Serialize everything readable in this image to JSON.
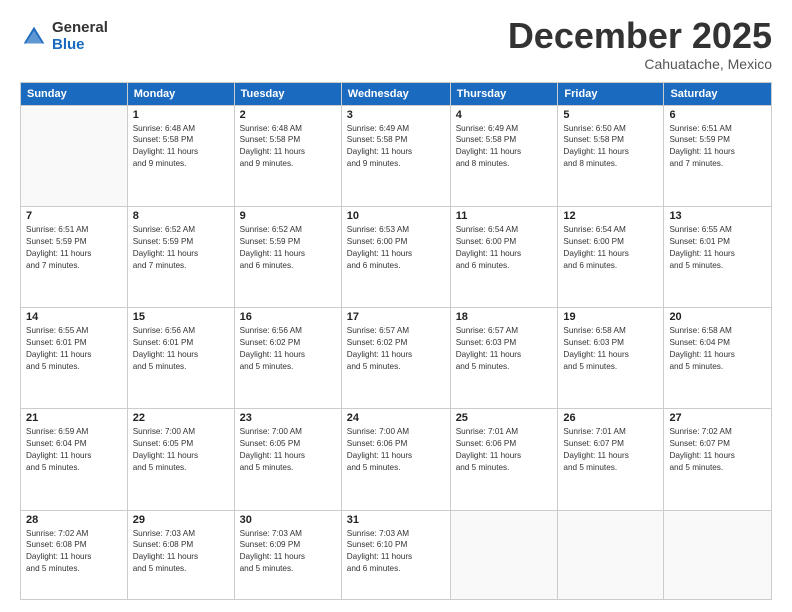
{
  "logo": {
    "general": "General",
    "blue": "Blue"
  },
  "header": {
    "month": "December 2025",
    "location": "Cahuatache, Mexico"
  },
  "weekdays": [
    "Sunday",
    "Monday",
    "Tuesday",
    "Wednesday",
    "Thursday",
    "Friday",
    "Saturday"
  ],
  "weeks": [
    [
      {
        "num": "",
        "info": ""
      },
      {
        "num": "1",
        "info": "Sunrise: 6:48 AM\nSunset: 5:58 PM\nDaylight: 11 hours\nand 9 minutes."
      },
      {
        "num": "2",
        "info": "Sunrise: 6:48 AM\nSunset: 5:58 PM\nDaylight: 11 hours\nand 9 minutes."
      },
      {
        "num": "3",
        "info": "Sunrise: 6:49 AM\nSunset: 5:58 PM\nDaylight: 11 hours\nand 9 minutes."
      },
      {
        "num": "4",
        "info": "Sunrise: 6:49 AM\nSunset: 5:58 PM\nDaylight: 11 hours\nand 8 minutes."
      },
      {
        "num": "5",
        "info": "Sunrise: 6:50 AM\nSunset: 5:58 PM\nDaylight: 11 hours\nand 8 minutes."
      },
      {
        "num": "6",
        "info": "Sunrise: 6:51 AM\nSunset: 5:59 PM\nDaylight: 11 hours\nand 7 minutes."
      }
    ],
    [
      {
        "num": "7",
        "info": "Sunrise: 6:51 AM\nSunset: 5:59 PM\nDaylight: 11 hours\nand 7 minutes."
      },
      {
        "num": "8",
        "info": "Sunrise: 6:52 AM\nSunset: 5:59 PM\nDaylight: 11 hours\nand 7 minutes."
      },
      {
        "num": "9",
        "info": "Sunrise: 6:52 AM\nSunset: 5:59 PM\nDaylight: 11 hours\nand 6 minutes."
      },
      {
        "num": "10",
        "info": "Sunrise: 6:53 AM\nSunset: 6:00 PM\nDaylight: 11 hours\nand 6 minutes."
      },
      {
        "num": "11",
        "info": "Sunrise: 6:54 AM\nSunset: 6:00 PM\nDaylight: 11 hours\nand 6 minutes."
      },
      {
        "num": "12",
        "info": "Sunrise: 6:54 AM\nSunset: 6:00 PM\nDaylight: 11 hours\nand 6 minutes."
      },
      {
        "num": "13",
        "info": "Sunrise: 6:55 AM\nSunset: 6:01 PM\nDaylight: 11 hours\nand 5 minutes."
      }
    ],
    [
      {
        "num": "14",
        "info": "Sunrise: 6:55 AM\nSunset: 6:01 PM\nDaylight: 11 hours\nand 5 minutes."
      },
      {
        "num": "15",
        "info": "Sunrise: 6:56 AM\nSunset: 6:01 PM\nDaylight: 11 hours\nand 5 minutes."
      },
      {
        "num": "16",
        "info": "Sunrise: 6:56 AM\nSunset: 6:02 PM\nDaylight: 11 hours\nand 5 minutes."
      },
      {
        "num": "17",
        "info": "Sunrise: 6:57 AM\nSunset: 6:02 PM\nDaylight: 11 hours\nand 5 minutes."
      },
      {
        "num": "18",
        "info": "Sunrise: 6:57 AM\nSunset: 6:03 PM\nDaylight: 11 hours\nand 5 minutes."
      },
      {
        "num": "19",
        "info": "Sunrise: 6:58 AM\nSunset: 6:03 PM\nDaylight: 11 hours\nand 5 minutes."
      },
      {
        "num": "20",
        "info": "Sunrise: 6:58 AM\nSunset: 6:04 PM\nDaylight: 11 hours\nand 5 minutes."
      }
    ],
    [
      {
        "num": "21",
        "info": "Sunrise: 6:59 AM\nSunset: 6:04 PM\nDaylight: 11 hours\nand 5 minutes."
      },
      {
        "num": "22",
        "info": "Sunrise: 7:00 AM\nSunset: 6:05 PM\nDaylight: 11 hours\nand 5 minutes."
      },
      {
        "num": "23",
        "info": "Sunrise: 7:00 AM\nSunset: 6:05 PM\nDaylight: 11 hours\nand 5 minutes."
      },
      {
        "num": "24",
        "info": "Sunrise: 7:00 AM\nSunset: 6:06 PM\nDaylight: 11 hours\nand 5 minutes."
      },
      {
        "num": "25",
        "info": "Sunrise: 7:01 AM\nSunset: 6:06 PM\nDaylight: 11 hours\nand 5 minutes."
      },
      {
        "num": "26",
        "info": "Sunrise: 7:01 AM\nSunset: 6:07 PM\nDaylight: 11 hours\nand 5 minutes."
      },
      {
        "num": "27",
        "info": "Sunrise: 7:02 AM\nSunset: 6:07 PM\nDaylight: 11 hours\nand 5 minutes."
      }
    ],
    [
      {
        "num": "28",
        "info": "Sunrise: 7:02 AM\nSunset: 6:08 PM\nDaylight: 11 hours\nand 5 minutes."
      },
      {
        "num": "29",
        "info": "Sunrise: 7:03 AM\nSunset: 6:08 PM\nDaylight: 11 hours\nand 5 minutes."
      },
      {
        "num": "30",
        "info": "Sunrise: 7:03 AM\nSunset: 6:09 PM\nDaylight: 11 hours\nand 5 minutes."
      },
      {
        "num": "31",
        "info": "Sunrise: 7:03 AM\nSunset: 6:10 PM\nDaylight: 11 hours\nand 6 minutes."
      },
      {
        "num": "",
        "info": ""
      },
      {
        "num": "",
        "info": ""
      },
      {
        "num": "",
        "info": ""
      }
    ]
  ]
}
